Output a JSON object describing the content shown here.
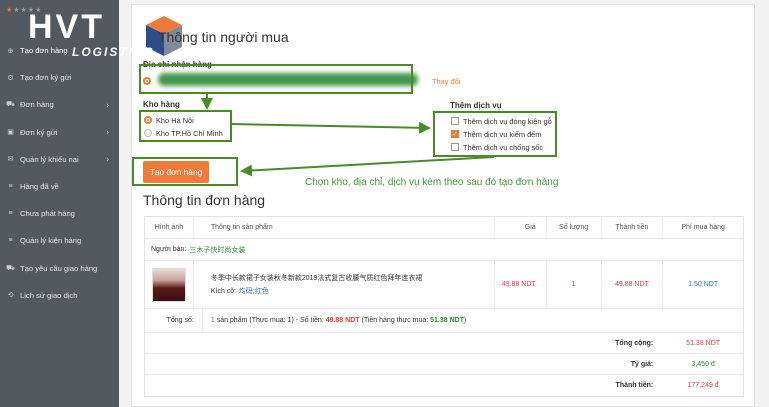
{
  "brand": {
    "logo_main": "HVT",
    "logo_sub": "LOGISTICS",
    "stars": "★★★★★"
  },
  "sidebar": {
    "items": [
      {
        "label": "Tạo đơn hàng",
        "icon": "plus-circle-icon",
        "active": true,
        "chevron": false
      },
      {
        "label": "Tạo đơn ký gửi",
        "icon": "gear-icon",
        "chevron": false
      },
      {
        "label": "Đơn hàng",
        "icon": "cart-icon",
        "chevron": true
      },
      {
        "label": "Đơn ký gửi",
        "icon": "box-icon",
        "chevron": true
      },
      {
        "label": "Quản lý khiếu nại",
        "icon": "chat-icon",
        "chevron": true
      },
      {
        "label": "Hàng đã về",
        "icon": "list-icon",
        "chevron": false
      },
      {
        "label": "Chưa phát hàng",
        "icon": "list-icon",
        "chevron": false
      },
      {
        "label": "Quản lý kiện hàng",
        "icon": "list-icon",
        "chevron": false
      },
      {
        "label": "Tạo yêu cầu giao hàng",
        "icon": "truck-icon",
        "chevron": false
      },
      {
        "label": "Lịch sử giao dịch",
        "icon": "history-icon",
        "chevron": false
      }
    ]
  },
  "buyer": {
    "title": "Thông tin người mua",
    "address_label": "Địa chỉ nhận hàng",
    "change_link": "Thay đổi",
    "warehouse_label": "Kho hàng",
    "warehouses": [
      "Kho Hà Nội",
      "Kho TP.Hồ Chí Minh"
    ],
    "services_label": "Thêm dịch vụ",
    "services": [
      {
        "label": "Thêm dịch vụ đóng kiện gỗ",
        "checked": false
      },
      {
        "label": "Thêm dịch vụ kiểm đếm",
        "checked": true
      },
      {
        "label": "Thêm dịch vụ chống sốc",
        "checked": false
      }
    ],
    "create_button": "Tạo đơn hàng",
    "annotation": "Chọn kho, địa chỉ, dịch vụ kèm theo sau đó tạo đơn hàng"
  },
  "order": {
    "title": "Thông tin đơn hàng",
    "headers": [
      "Hình ảnh",
      "Thông tin sản phẩm",
      "Giá",
      "Số lượng",
      "Thành tiền",
      "Phí mua hàng"
    ],
    "seller_label": "Người bán:",
    "seller_name": "三木子快时尚女装",
    "product": {
      "name": "冬季中长款裙子女装秋冬新款2019法式复古收腰气质红色拜年连衣裙",
      "size_label": "Kích cỡ:",
      "size_value": "均码;红色",
      "price": "49.88 NDT",
      "qty": "1",
      "total": "49.88 NDT",
      "fee": "1.50 NDT"
    },
    "summary": {
      "label": "Tổng số:",
      "count": "1",
      "text_a": "sản phẩm (Thực mua:",
      "actual": "1",
      "text_b": ") - Số tiền:",
      "amount": "49.88 NDT",
      "text_c": "(Tiền hàng thực mua:",
      "actual_amount": "51.38 NDT",
      "text_d": ")"
    },
    "totals": [
      {
        "label": "Tổng cộng:",
        "value": "51.38 NDT",
        "color": "red"
      },
      {
        "label": "Tỷ giá:",
        "value": "3,450 đ",
        "color": "green"
      },
      {
        "label": "Thành tiền:",
        "value": "177,249 đ",
        "color": "red"
      }
    ]
  }
}
